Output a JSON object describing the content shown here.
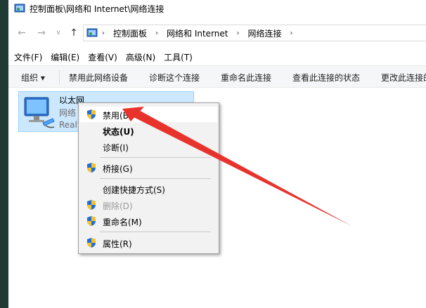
{
  "window": {
    "title": "控制面板\\网络和 Internet\\网络连接"
  },
  "nav": {
    "back_glyph": "←",
    "forward_glyph": "→",
    "history_glyph": "∨",
    "up_glyph": "↑",
    "breadcrumb": [
      "控制面板",
      "网络和 Internet",
      "网络连接"
    ],
    "separator": "›"
  },
  "menubar": [
    "文件(F)",
    "编辑(E)",
    "查看(V)",
    "高级(N)",
    "工具(T)"
  ],
  "commands": {
    "organize": "组织 ▾",
    "disable_device": "禁用此网络设备",
    "diagnose": "诊断这个连接",
    "rename": "重命名此连接",
    "view_status": "查看此连接的状态",
    "change_settings": "更改此连接的设置"
  },
  "adapter": {
    "name": "以太网",
    "status": "网络",
    "device": "Realt"
  },
  "context_menu": {
    "disable": "禁用(B)",
    "status": "状态(U)",
    "diagnose": "诊断(I)",
    "bridge": "桥接(G)",
    "shortcut": "创建快捷方式(S)",
    "delete": "删除(D)",
    "rename": "重命名(M)",
    "properties": "属性(R)"
  },
  "colors": {
    "accent_selection": "#cce8ff",
    "annotation_arrow": "#e8322c",
    "left_strip": "#1f3b33"
  }
}
